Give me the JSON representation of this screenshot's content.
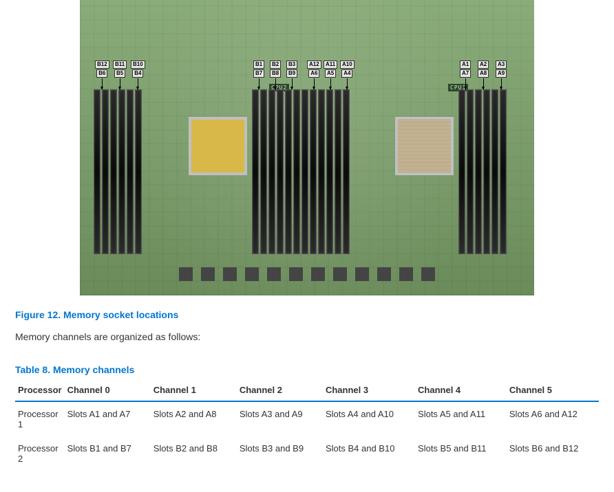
{
  "board": {
    "cpu_labels": {
      "cpu2": "CPU2",
      "cpu1": "CPU1"
    },
    "left_bank": [
      {
        "top": "B12",
        "bot": "B6"
      },
      {
        "top": "B11",
        "bot": "B5"
      },
      {
        "top": "B10",
        "bot": "B4"
      }
    ],
    "mid_bank": [
      {
        "top": "B1",
        "bot": "B7"
      },
      {
        "top": "B2",
        "bot": "B8"
      },
      {
        "top": "B3",
        "bot": "B9"
      },
      {
        "top": "A12",
        "bot": "A6"
      },
      {
        "top": "A11",
        "bot": "A5"
      },
      {
        "top": "A10",
        "bot": "A4"
      }
    ],
    "right_bank": [
      {
        "top": "A1",
        "bot": "A7"
      },
      {
        "top": "A2",
        "bot": "A8"
      },
      {
        "top": "A3",
        "bot": "A9"
      }
    ]
  },
  "figure_caption": "Figure 12. Memory socket locations",
  "intro_text": "Memory channels are organized as follows:",
  "table_title": "Table 8. Memory channels",
  "table": {
    "headers": [
      "Processor",
      "Channel 0",
      "Channel 1",
      "Channel 2",
      "Channel 3",
      "Channel 4",
      "Channel 5"
    ],
    "rows": [
      {
        "proc": "Processor 1",
        "cells": [
          "Slots A1 and A7",
          "Slots A2 and A8",
          "Slots A3 and A9",
          "Slots A4 and A10",
          "Slots A5 and A11",
          "Slots A6 and A12"
        ]
      },
      {
        "proc": "Processor 2",
        "cells": [
          "Slots B1 and B7",
          "Slots B2 and B8",
          "Slots B3 and B9",
          "Slots B4 and B10",
          "Slots B5 and B11",
          "Slots B6 and B12"
        ]
      }
    ]
  }
}
